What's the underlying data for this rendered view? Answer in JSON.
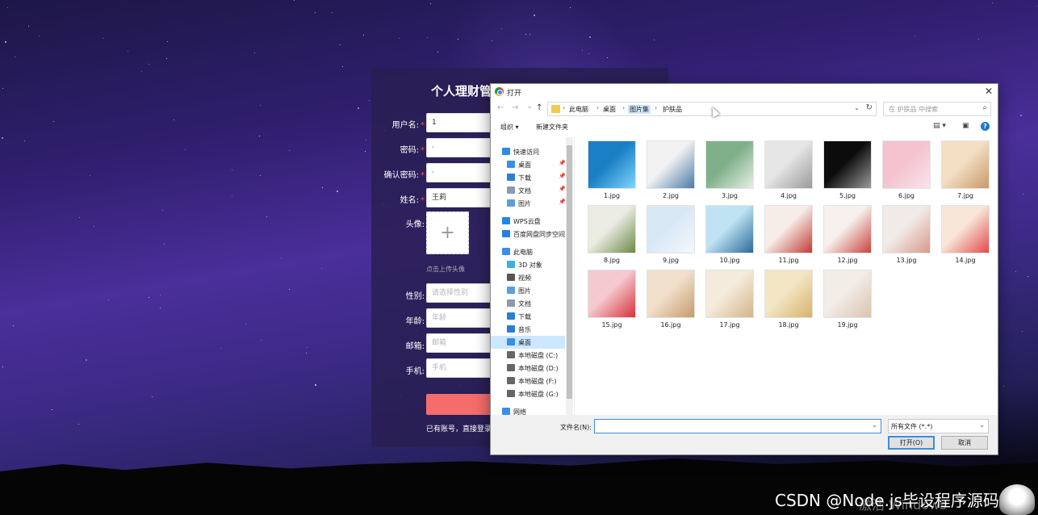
{
  "form": {
    "title": "个人理财管",
    "username_label": "用户名:",
    "username_value": "1",
    "password_label": "密码:",
    "password_value": "·",
    "confirm_label": "确认密码:",
    "confirm_value": "·",
    "name_label": "姓名:",
    "name_value": "王莉",
    "avatar_label": "头像:",
    "avatar_plus": "+",
    "avatar_hint": "点击上传头像",
    "gender_label": "性别:",
    "gender_placeholder": "请选择性别",
    "age_label": "年龄:",
    "age_placeholder": "年龄",
    "email_label": "邮箱:",
    "email_placeholder": "邮箱",
    "phone_label": "手机:",
    "phone_placeholder": "手机",
    "required_mark": "*",
    "login_link": "已有账号，直接登录"
  },
  "dialog": {
    "title": "打开",
    "close": "✕",
    "nav_back": "←",
    "nav_forward": "→",
    "nav_recent": "⌄",
    "nav_up": "↑",
    "breadcrumb": [
      "此电脑",
      "桌面",
      "图片集",
      "护肤品"
    ],
    "crumb_sep": "›",
    "addr_dropdown": "⌄",
    "refresh": "↻",
    "search_placeholder": "在 护肤品 中搜索",
    "search_icon": "⌕",
    "organize": "组织 ▾",
    "new_folder": "新建文件夹",
    "view_menu": "▤ ▾",
    "preview_pane": "▣",
    "help": "?",
    "sidebar": [
      {
        "label": "快速访问",
        "icon": "star-icon",
        "color": "#2b8de0",
        "indent": 0
      },
      {
        "label": "桌面",
        "icon": "desktop-icon",
        "color": "#3a8ee6",
        "indent": 1,
        "pin": "📌"
      },
      {
        "label": "下载",
        "icon": "download-icon",
        "color": "#2b7fd1",
        "indent": 1,
        "pin": "📌"
      },
      {
        "label": "文档",
        "icon": "document-icon",
        "color": "#8a9bb0",
        "indent": 1,
        "pin": "📌"
      },
      {
        "label": "图片",
        "icon": "picture-icon",
        "color": "#5aa0d8",
        "indent": 1,
        "pin": "📌"
      },
      {
        "label": "WPS云盘",
        "icon": "cloud-icon",
        "color": "#1e88e5",
        "indent": 0
      },
      {
        "label": "百度网盘同步空间",
        "icon": "baidu-icon",
        "color": "#2a7ee0",
        "indent": 0
      },
      {
        "label": "此电脑",
        "icon": "computer-icon",
        "color": "#3a8ee6",
        "indent": 0
      },
      {
        "label": "3D 对象",
        "icon": "cube-icon",
        "color": "#3cb0e0",
        "indent": 1
      },
      {
        "label": "视频",
        "icon": "video-icon",
        "color": "#555555",
        "indent": 1
      },
      {
        "label": "图片",
        "icon": "picture-icon",
        "color": "#5aa0d8",
        "indent": 1
      },
      {
        "label": "文档",
        "icon": "document-icon",
        "color": "#8a9bb0",
        "indent": 1
      },
      {
        "label": "下载",
        "icon": "download-icon",
        "color": "#2b7fd1",
        "indent": 1
      },
      {
        "label": "音乐",
        "icon": "music-icon",
        "color": "#2b7fd1",
        "indent": 1
      },
      {
        "label": "桌面",
        "icon": "desktop-icon",
        "color": "#3a8ee6",
        "indent": 1,
        "selected": true
      },
      {
        "label": "本地磁盘 (C:)",
        "icon": "drive-icon",
        "color": "#666666",
        "indent": 1
      },
      {
        "label": "本地磁盘 (D:)",
        "icon": "drive-icon",
        "color": "#666666",
        "indent": 1
      },
      {
        "label": "本地磁盘 (F:)",
        "icon": "drive-icon",
        "color": "#666666",
        "indent": 1
      },
      {
        "label": "本地磁盘 (G:)",
        "icon": "drive-icon",
        "color": "#666666",
        "indent": 1
      },
      {
        "label": "网络",
        "icon": "network-icon",
        "color": "#3a8ee6",
        "indent": 0
      }
    ],
    "files": [
      {
        "name": "1.jpg",
        "colors": [
          "#1a7fc4",
          "#7fd6ff"
        ]
      },
      {
        "name": "2.jpg",
        "colors": [
          "#f2f2f2",
          "#4a7aa8"
        ]
      },
      {
        "name": "3.jpg",
        "colors": [
          "#7fb08a",
          "#e8efe6"
        ]
      },
      {
        "name": "4.jpg",
        "colors": [
          "#e6e6e6",
          "#9a9a9a"
        ]
      },
      {
        "name": "5.jpg",
        "colors": [
          "#0c0c0c",
          "#9a9a9a"
        ]
      },
      {
        "name": "6.jpg",
        "colors": [
          "#f4c3cf",
          "#f9e3ea"
        ]
      },
      {
        "name": "7.jpg",
        "colors": [
          "#f3dfc4",
          "#c79a6a"
        ]
      },
      {
        "name": "8.jpg",
        "colors": [
          "#ecece4",
          "#6a8a45"
        ]
      },
      {
        "name": "9.jpg",
        "colors": [
          "#d8e8f5",
          "#f4f8fb"
        ]
      },
      {
        "name": "10.jpg",
        "colors": [
          "#bfe3f2",
          "#2a6a9a"
        ]
      },
      {
        "name": "11.jpg",
        "colors": [
          "#f6ede8",
          "#c23a35"
        ]
      },
      {
        "name": "12.jpg",
        "colors": [
          "#f7f0ec",
          "#c8423e"
        ]
      },
      {
        "name": "13.jpg",
        "colors": [
          "#f1ebe8",
          "#d89a8a"
        ]
      },
      {
        "name": "14.jpg",
        "colors": [
          "#f8e6d8",
          "#e24a4a"
        ]
      },
      {
        "name": "15.jpg",
        "colors": [
          "#f4c9cf",
          "#d8323a"
        ]
      },
      {
        "name": "16.jpg",
        "colors": [
          "#f1e0cc",
          "#c89a6a"
        ]
      },
      {
        "name": "17.jpg",
        "colors": [
          "#f4ebdc",
          "#d4b48a"
        ]
      },
      {
        "name": "18.jpg",
        "colors": [
          "#f2e6c4",
          "#d8b26a"
        ]
      },
      {
        "name": "19.jpg",
        "colors": [
          "#f3ede7",
          "#d9c3b0"
        ]
      }
    ],
    "filename_label": "文件名(N):",
    "filename_value": "",
    "filetype_value": "所有文件 (*.*)",
    "dropdown": "⌄",
    "open_button": "打开(O)",
    "cancel_button": "取消"
  },
  "overlay": {
    "watermark": "CSDN @Node.js毕设程序源码",
    "activate_windows": "激活 Windows"
  }
}
